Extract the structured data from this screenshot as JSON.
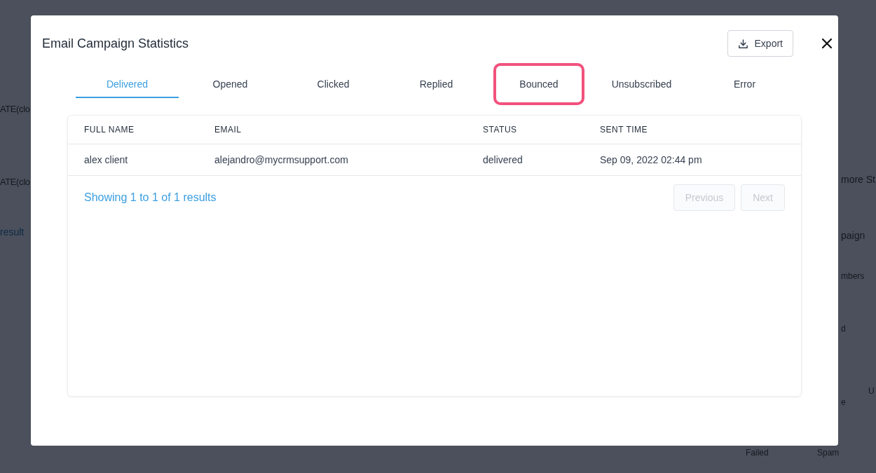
{
  "background": {
    "left_fragments": [
      "ATE(clo",
      "ATE(clo",
      "result"
    ],
    "right_fragments": [
      "more St",
      "paign",
      "mbers",
      "d",
      "e",
      "U",
      "Failed",
      "Spam"
    ]
  },
  "dialog": {
    "title": "Email Campaign Statistics",
    "export_button": "Export",
    "tabs": [
      {
        "label": "Delivered",
        "selected": true,
        "highlighted": false
      },
      {
        "label": "Opened",
        "selected": false,
        "highlighted": false
      },
      {
        "label": "Clicked",
        "selected": false,
        "highlighted": false
      },
      {
        "label": "Replied",
        "selected": false,
        "highlighted": false
      },
      {
        "label": "Bounced",
        "selected": false,
        "highlighted": true
      },
      {
        "label": "Unsubscribed",
        "selected": false,
        "highlighted": false
      },
      {
        "label": "Error",
        "selected": false,
        "highlighted": false
      }
    ],
    "table": {
      "columns": [
        "FULL NAME",
        "EMAIL",
        "STATUS",
        "SENT TIME"
      ],
      "rows": [
        [
          "alex client",
          "alejandro@mycrmsupport.com",
          "delivered",
          "Sep 09, 2022 02:44 pm"
        ]
      ]
    },
    "summary": "Showing 1 to 1 of 1 results",
    "pagination": [
      {
        "label": "Previous",
        "disabled": true
      },
      {
        "label": "Next",
        "disabled": true
      }
    ]
  }
}
